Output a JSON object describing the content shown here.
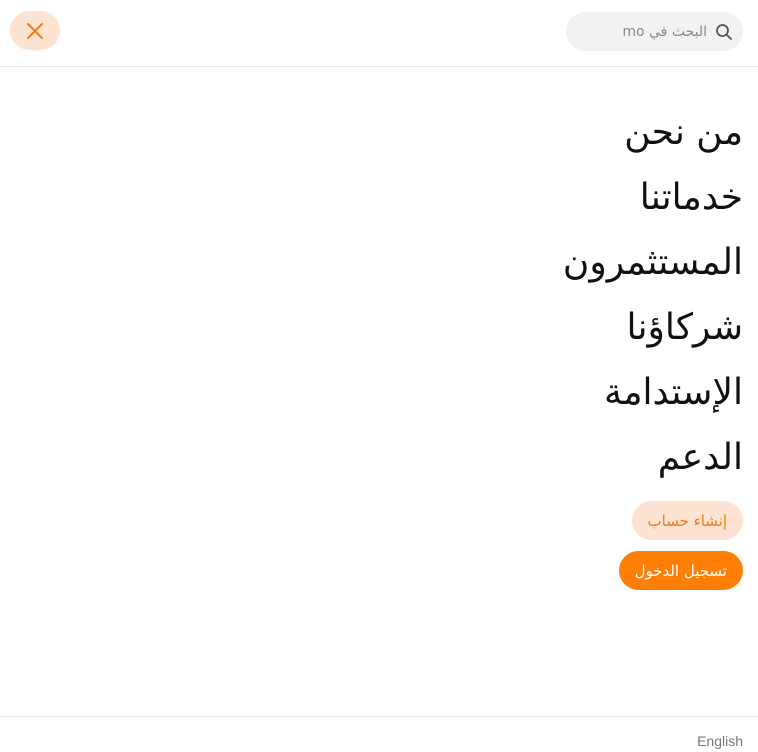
{
  "header": {
    "search": {
      "placeholder": "البحث في mo",
      "value": ""
    }
  },
  "menu": {
    "items": [
      {
        "label": "من نحن"
      },
      {
        "label": "خدماتنا"
      },
      {
        "label": "المستثمرون"
      },
      {
        "label": "شركاؤنا"
      },
      {
        "label": "الإستدامة"
      },
      {
        "label": "الدعم"
      }
    ]
  },
  "actions": {
    "signup_label": "إنشاء حساب",
    "login_label": "تسجيل الدخول"
  },
  "footer": {
    "language_label": "English"
  },
  "colors": {
    "accent": "#ff7f06",
    "accent_soft": "#fde3d1",
    "search_bg": "#f2f2f2",
    "divider": "#e7e7e7"
  },
  "icons": {
    "close": "close-icon",
    "search": "search-icon"
  }
}
